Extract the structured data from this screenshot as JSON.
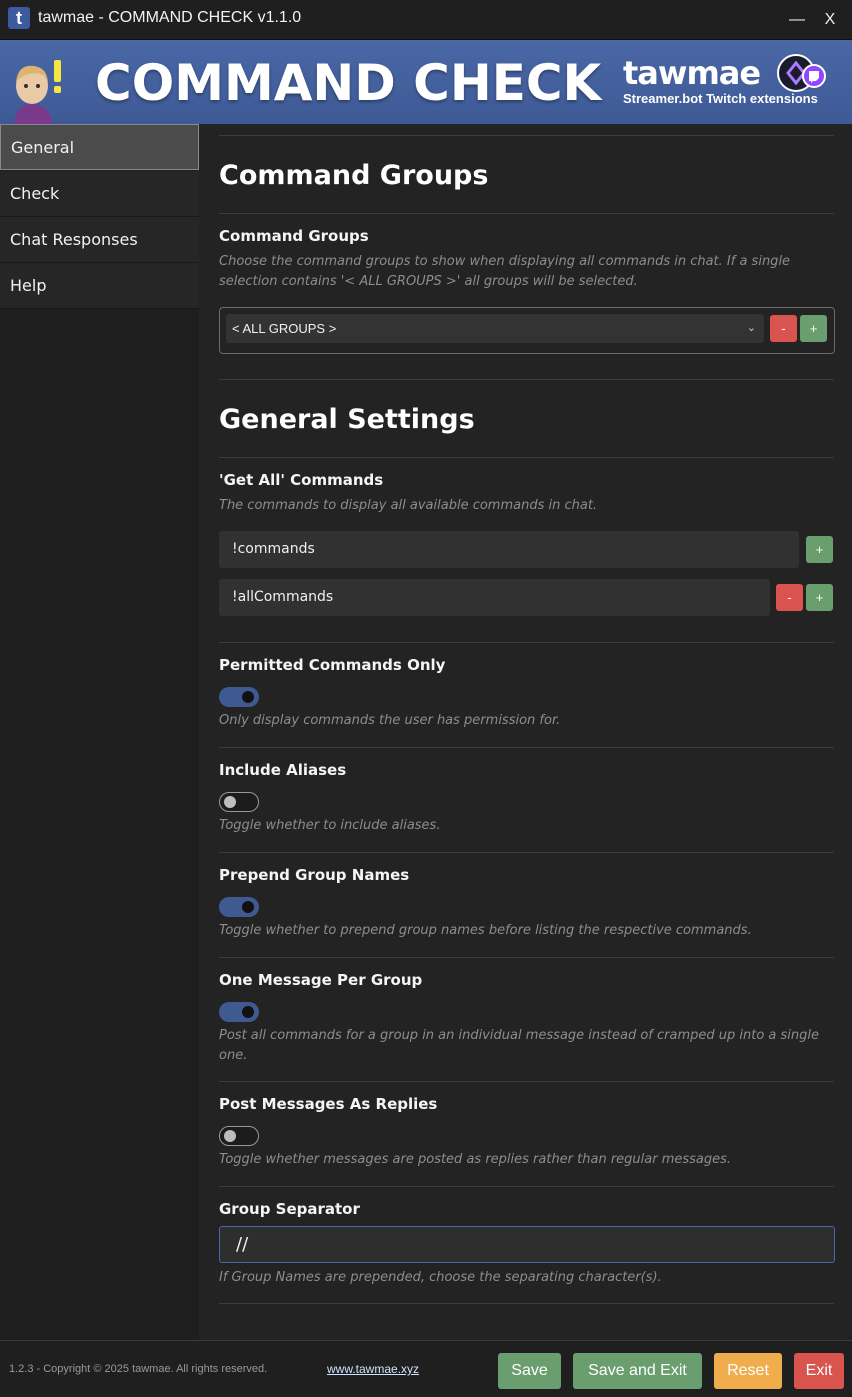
{
  "window": {
    "title": "tawmae - COMMAND CHECK v1.1.0",
    "app_icon_letter": "t",
    "minimize": "—",
    "close": "X"
  },
  "banner": {
    "title": "COMMAND CHECK",
    "brand_name": "tawmae",
    "brand_subtitle": "Streamer.bot Twitch extensions"
  },
  "sidebar": {
    "items": [
      {
        "label": "General"
      },
      {
        "label": "Check"
      },
      {
        "label": "Chat Responses"
      },
      {
        "label": "Help"
      }
    ]
  },
  "command_groups": {
    "heading": "Command Groups",
    "field_label": "Command Groups",
    "description": "Choose the command groups to show when displaying all commands in chat. If a single selection contains '< ALL GROUPS >' all groups will be selected.",
    "selected": "< ALL GROUPS >",
    "chevron": "⌄",
    "minus": "-",
    "plus": "+"
  },
  "general_settings": {
    "heading": "General Settings",
    "get_all": {
      "label": "'Get All' Commands",
      "description": "The commands to display all available commands in chat.",
      "commands": [
        "!commands",
        "!allCommands"
      ],
      "minus": "-",
      "plus": "+"
    },
    "permitted_only": {
      "label": "Permitted Commands Only",
      "description": "Only display commands the user has permission for.",
      "on": true
    },
    "include_aliases": {
      "label": "Include Aliases",
      "description": "Toggle whether to include aliases.",
      "on": false
    },
    "prepend_group_names": {
      "label": "Prepend Group Names",
      "description": "Toggle whether to prepend group names before listing the respective commands.",
      "on": true
    },
    "one_message_per_group": {
      "label": "One Message Per Group",
      "description": "Post all commands for a group in an individual message instead of cramped up into a single one.",
      "on": true
    },
    "post_as_replies": {
      "label": "Post Messages As Replies",
      "description": "Toggle whether messages are posted as replies rather than regular messages.",
      "on": false
    },
    "group_separator": {
      "label": "Group Separator",
      "value": "//",
      "description": "If Group Names are prepended, choose the separating character(s)."
    }
  },
  "footer": {
    "copyright": "1.2.3 - Copyright © 2025 tawmae. All rights reserved.",
    "link": "www.tawmae.xyz",
    "save": "Save",
    "save_exit": "Save and Exit",
    "reset": "Reset",
    "exit": "Exit"
  },
  "colors": {
    "banner": "#4a67a6",
    "toggle_on": "#3f5a90",
    "green": "#6b9e6e",
    "red": "#d9534f",
    "orange": "#f0ad4e"
  }
}
